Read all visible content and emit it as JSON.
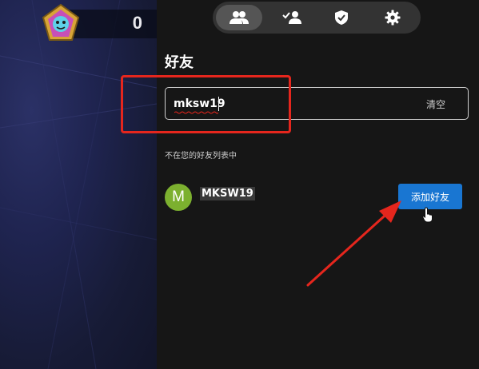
{
  "game": {
    "score": "0"
  },
  "nav": {
    "tabs": [
      {
        "icon": "friends-icon",
        "active": true
      },
      {
        "icon": "friend-requests-icon",
        "active": false
      },
      {
        "icon": "shield-check-icon",
        "active": false
      },
      {
        "icon": "gear-icon",
        "active": false
      }
    ]
  },
  "friends": {
    "title": "好友",
    "search": {
      "value": "mksw19",
      "clear_label": "清空"
    },
    "section_label": "不在您的好友列表中",
    "results": [
      {
        "avatar_letter": "M",
        "avatar_color": "#7cb02f",
        "name": "MKSW19",
        "action_label": "添加好友"
      }
    ]
  },
  "colors": {
    "accent": "#1976d2",
    "annotation": "#e5261d",
    "panel": "#161616"
  }
}
